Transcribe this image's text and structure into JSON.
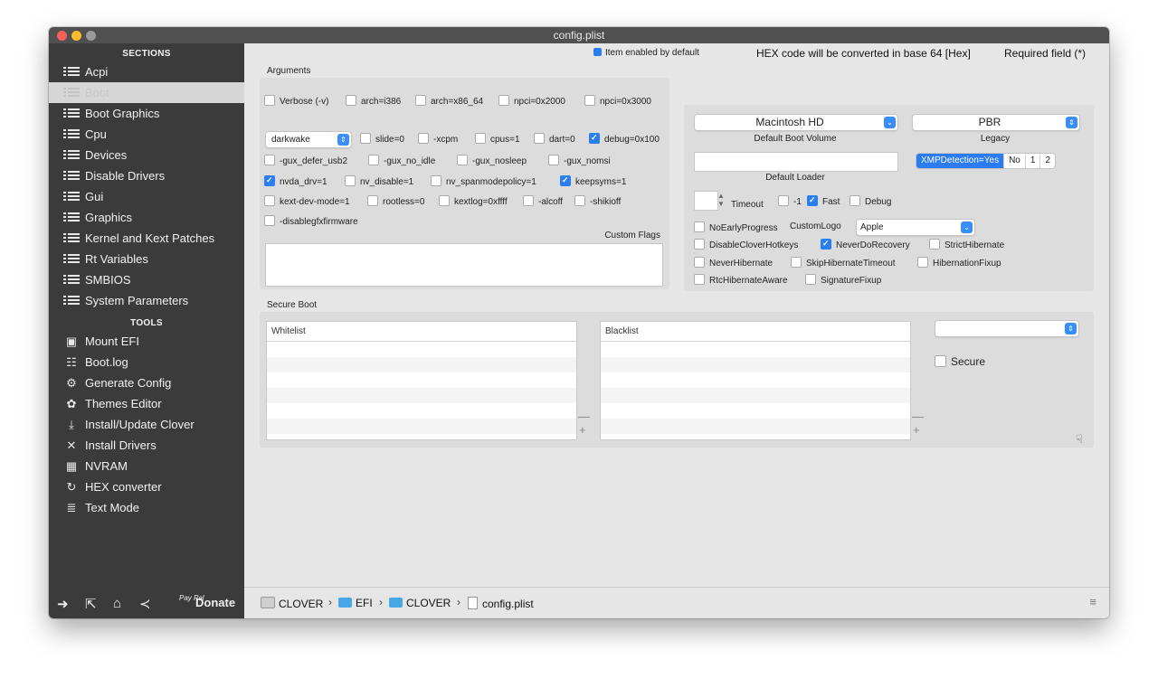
{
  "window": {
    "title": "config.plist"
  },
  "sidebar": {
    "sections_header": "SECTIONS",
    "sections": [
      {
        "label": "Acpi"
      },
      {
        "label": "Boot",
        "selected": true
      },
      {
        "label": "Boot Graphics"
      },
      {
        "label": "Cpu"
      },
      {
        "label": "Devices"
      },
      {
        "label": "Disable Drivers"
      },
      {
        "label": "Gui"
      },
      {
        "label": "Graphics"
      },
      {
        "label": "Kernel and Kext Patches"
      },
      {
        "label": "Rt Variables"
      },
      {
        "label": "SMBIOS"
      },
      {
        "label": "System Parameters"
      }
    ],
    "tools_header": "TOOLS",
    "tools": [
      {
        "label": "Mount EFI",
        "icon": "disk-icon"
      },
      {
        "label": "Boot.log",
        "icon": "log-search-icon"
      },
      {
        "label": "Generate Config",
        "icon": "gears-icon"
      },
      {
        "label": "Themes Editor",
        "icon": "palette-icon"
      },
      {
        "label": "Install/Update Clover",
        "icon": "download-icon"
      },
      {
        "label": "Install Drivers",
        "icon": "tools-icon"
      },
      {
        "label": "NVRAM",
        "icon": "chip-icon"
      },
      {
        "label": "HEX converter",
        "icon": "refresh-icon"
      },
      {
        "label": "Text Mode",
        "icon": "text-lines-icon"
      }
    ],
    "footer": {
      "paypal": "Pay Pal",
      "donate": "Donate"
    }
  },
  "header": {
    "item_enabled_note": "Item enabled by default",
    "hex_note": "HEX code will be converted in base 64 [Hex]",
    "required_note": "Required field (*)"
  },
  "arguments": {
    "label": "Arguments",
    "row1": [
      {
        "label": "Verbose (-v)",
        "checked": false
      },
      {
        "label": "arch=i386",
        "checked": false
      },
      {
        "label": "arch=x86_64",
        "checked": false
      },
      {
        "label": "npci=0x2000",
        "checked": false
      },
      {
        "label": "npci=0x3000",
        "checked": false
      }
    ],
    "darkwake_value": "darkwake",
    "row2": [
      {
        "label": "slide=0",
        "checked": false
      },
      {
        "label": "-xcpm",
        "checked": false
      },
      {
        "label": "cpus=1",
        "checked": false
      },
      {
        "label": "dart=0",
        "checked": false
      },
      {
        "label": "debug=0x100",
        "checked": true
      }
    ],
    "row3": [
      {
        "label": "-gux_defer_usb2",
        "checked": false
      },
      {
        "label": "-gux_no_idle",
        "checked": false
      },
      {
        "label": "-gux_nosleep",
        "checked": false
      },
      {
        "label": "-gux_nomsi",
        "checked": false
      }
    ],
    "row4": [
      {
        "label": "nvda_drv=1",
        "checked": true
      },
      {
        "label": "nv_disable=1",
        "checked": false
      },
      {
        "label": "nv_spanmodepolicy=1",
        "checked": false
      },
      {
        "label": "keepsyms=1",
        "checked": true
      }
    ],
    "row5": [
      {
        "label": "kext-dev-mode=1",
        "checked": false
      },
      {
        "label": "rootless=0",
        "checked": false
      },
      {
        "label": "kextlog=0xffff",
        "checked": false
      },
      {
        "label": "-alcoff",
        "checked": false
      },
      {
        "label": "-shikioff",
        "checked": false
      }
    ],
    "row6": [
      {
        "label": "-disablegfxfirmware",
        "checked": false
      }
    ],
    "custom_flags_label": "Custom Flags",
    "custom_flags_value": ""
  },
  "boot": {
    "default_volume": "Macintosh HD",
    "default_volume_caption": "Default Boot Volume",
    "legacy": "PBR",
    "legacy_caption": "Legacy",
    "default_loader_value": "",
    "default_loader_caption": "Default Loader",
    "xmp": {
      "options": [
        "XMPDetection=Yes",
        "No",
        "1",
        "2"
      ],
      "selected": "XMPDetection=Yes"
    },
    "timeout_label": "Timeout",
    "timeout_value": "",
    "timeout_flags": [
      {
        "label": "-1",
        "checked": false
      },
      {
        "label": "Fast",
        "checked": true
      },
      {
        "label": "Debug",
        "checked": false
      }
    ],
    "no_early_progress": {
      "label": "NoEarlyProgress",
      "checked": false
    },
    "custom_logo_label": "CustomLogo",
    "custom_logo_value": "Apple",
    "flags_row1": [
      {
        "label": "DisableCloverHotkeys",
        "checked": false
      },
      {
        "label": "NeverDoRecovery",
        "checked": true
      },
      {
        "label": "StrictHibernate",
        "checked": false
      }
    ],
    "flags_row2": [
      {
        "label": "NeverHibernate",
        "checked": false
      },
      {
        "label": "SkipHibernateTimeout",
        "checked": false
      },
      {
        "label": "HibernationFixup",
        "checked": false
      }
    ],
    "flags_row3": [
      {
        "label": "RtcHibernateAware",
        "checked": false
      },
      {
        "label": "SignatureFixup",
        "checked": false
      }
    ]
  },
  "secure_boot": {
    "label": "Secure Boot",
    "whitelist_header": "Whitelist",
    "blacklist_header": "Blacklist",
    "policy_value": "",
    "secure": {
      "label": "Secure",
      "checked": false
    },
    "add": "+",
    "remove": "—"
  },
  "pathbar": [
    "CLOVER",
    "EFI",
    "CLOVER",
    "config.plist"
  ]
}
